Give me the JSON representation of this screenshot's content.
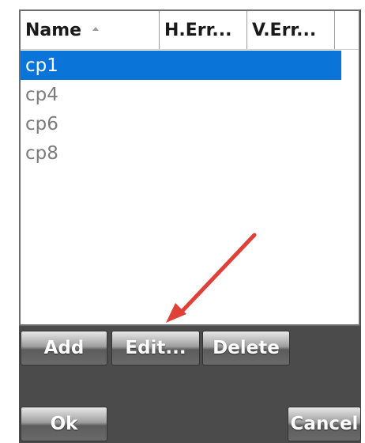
{
  "list": {
    "columns": [
      {
        "label": "Name"
      },
      {
        "label": "H.Err..."
      },
      {
        "label": "V.Err..."
      },
      {
        "label": ""
      }
    ],
    "rows": [
      "cp1",
      "cp4",
      "cp6",
      "cp8"
    ],
    "selected_index": 0
  },
  "buttons": {
    "add": "Add",
    "edit": "Edit...",
    "delete": "Delete",
    "ok": "Ok",
    "cancel": "Cancel"
  },
  "colors": {
    "selection": "#0a74d9",
    "annotation_arrow": "#e0403a",
    "panel_background": "#4b4b4b"
  }
}
